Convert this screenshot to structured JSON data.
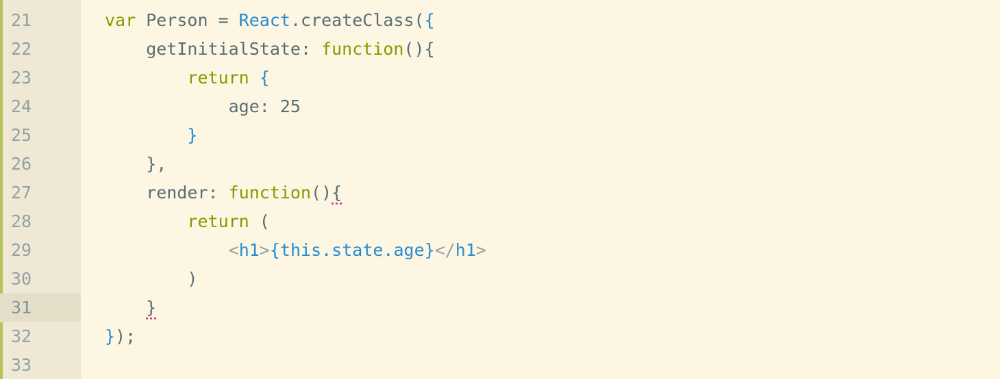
{
  "editor": {
    "line_numbers": [
      "21",
      "22",
      "23",
      "24",
      "25",
      "26",
      "27",
      "28",
      "29",
      "30",
      "31",
      "32",
      "33"
    ],
    "active_line": "31",
    "lines": [
      [
        {
          "t": "var",
          "k": "kw"
        },
        {
          "t": " Person = ",
          "k": "ident"
        },
        {
          "t": "React",
          "k": "obj"
        },
        {
          "t": ".createClass(",
          "k": "punct"
        },
        {
          "t": "{",
          "k": "brace"
        }
      ],
      [
        {
          "t": "    getInitialState: ",
          "k": "ident"
        },
        {
          "t": "function",
          "k": "fn"
        },
        {
          "t": "(){",
          "k": "punct"
        }
      ],
      [
        {
          "t": "        ",
          "k": "ident"
        },
        {
          "t": "return",
          "k": "kw"
        },
        {
          "t": " ",
          "k": "ident"
        },
        {
          "t": "{",
          "k": "brace"
        }
      ],
      [
        {
          "t": "            age: 25",
          "k": "ident"
        }
      ],
      [
        {
          "t": "        ",
          "k": "ident"
        },
        {
          "t": "}",
          "k": "brace"
        }
      ],
      [
        {
          "t": "    },",
          "k": "punct"
        }
      ],
      [
        {
          "t": "    render: ",
          "k": "ident"
        },
        {
          "t": "function",
          "k": "fn"
        },
        {
          "t": "()",
          "k": "punct"
        },
        {
          "t": "{",
          "k": "punct",
          "sq": true
        }
      ],
      [
        {
          "t": "        ",
          "k": "ident"
        },
        {
          "t": "return",
          "k": "kw"
        },
        {
          "t": " (",
          "k": "punct"
        }
      ],
      [
        {
          "t": "            ",
          "k": "ident"
        },
        {
          "t": "<",
          "k": "angle"
        },
        {
          "t": "h1",
          "k": "tag"
        },
        {
          "t": ">",
          "k": "angle"
        },
        {
          "t": "{this.state.age}",
          "k": "brace"
        },
        {
          "t": "</",
          "k": "angle"
        },
        {
          "t": "h1",
          "k": "tag"
        },
        {
          "t": ">",
          "k": "angle"
        }
      ],
      [
        {
          "t": "        )",
          "k": "punct"
        }
      ],
      [
        {
          "t": "    ",
          "k": "ident"
        },
        {
          "t": "}",
          "k": "punct",
          "sq": true
        }
      ],
      [
        {
          "t": "}",
          "k": "brace"
        },
        {
          "t": ");",
          "k": "punct"
        }
      ],
      [
        {
          "t": "",
          "k": "ident"
        }
      ]
    ]
  },
  "colors": {
    "background": "#fdf6e3",
    "gutter": "#eee8d5",
    "keyword": "#859900",
    "identifier": "#586e75",
    "object": "#268bd2",
    "error_underline": "#d33682"
  }
}
